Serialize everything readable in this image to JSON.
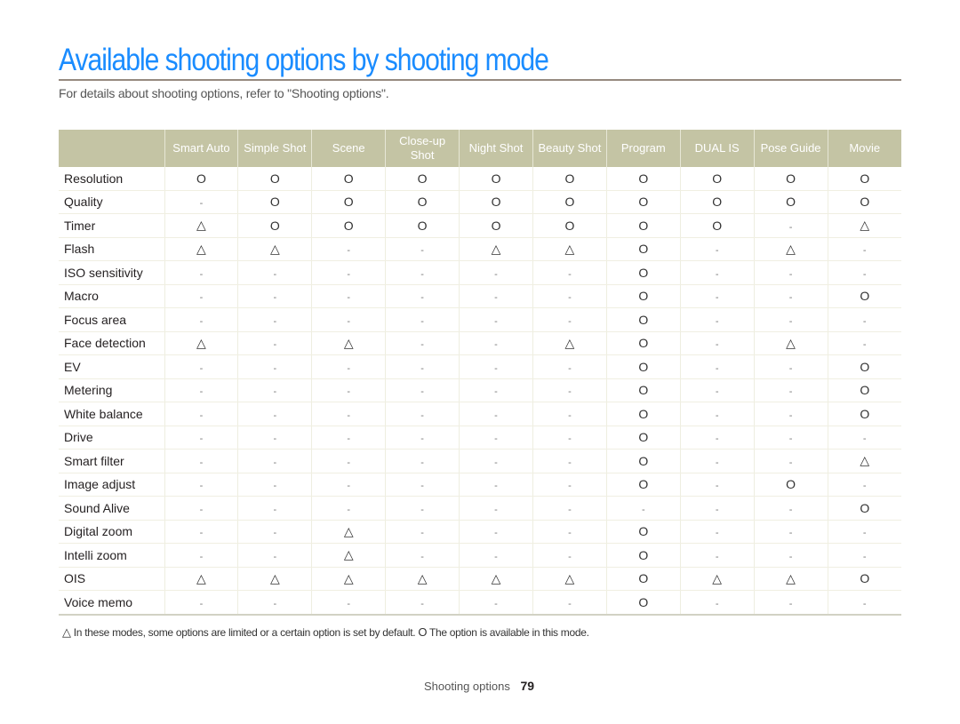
{
  "page": {
    "title": "Available shooting options by shooting mode",
    "subtitle": "For details about shooting options, refer to \"Shooting options\".",
    "footer_section": "Shooting options",
    "page_number": "79"
  },
  "legend": {
    "triangle_symbol": "△",
    "triangle_text": "In these modes, some options are limited or a certain option is set by default.",
    "circle_symbol": "O",
    "circle_text": "The option is available in this mode."
  },
  "symbols": {
    "O": "circle-icon",
    "T": "triangle-icon",
    "-": "dash"
  },
  "table": {
    "headers": [
      "",
      "Smart Auto",
      "Simple Shot",
      "Scene",
      "Close-up Shot",
      "Night Shot",
      "Beauty Shot",
      "Program",
      "DUAL IS",
      "Pose Guide",
      "Movie"
    ],
    "rows": [
      {
        "label": "Resolution",
        "cells": [
          "O",
          "O",
          "O",
          "O",
          "O",
          "O",
          "O",
          "O",
          "O",
          "O"
        ]
      },
      {
        "label": "Quality",
        "cells": [
          "-",
          "O",
          "O",
          "O",
          "O",
          "O",
          "O",
          "O",
          "O",
          "O"
        ]
      },
      {
        "label": "Timer",
        "cells": [
          "T",
          "O",
          "O",
          "O",
          "O",
          "O",
          "O",
          "O",
          "-",
          "T"
        ]
      },
      {
        "label": "Flash",
        "cells": [
          "T",
          "T",
          "-",
          "-",
          "T",
          "T",
          "O",
          "-",
          "T",
          "-"
        ]
      },
      {
        "label": "ISO sensitivity",
        "cells": [
          "-",
          "-",
          "-",
          "-",
          "-",
          "-",
          "O",
          "-",
          "-",
          "-"
        ]
      },
      {
        "label": "Macro",
        "cells": [
          "-",
          "-",
          "-",
          "-",
          "-",
          "-",
          "O",
          "-",
          "-",
          "O"
        ]
      },
      {
        "label": "Focus area",
        "cells": [
          "-",
          "-",
          "-",
          "-",
          "-",
          "-",
          "O",
          "-",
          "-",
          "-"
        ]
      },
      {
        "label": "Face detection",
        "cells": [
          "T",
          "-",
          "T",
          "-",
          "-",
          "T",
          "O",
          "-",
          "T",
          "-"
        ]
      },
      {
        "label": "EV",
        "cells": [
          "-",
          "-",
          "-",
          "-",
          "-",
          "-",
          "O",
          "-",
          "-",
          "O"
        ]
      },
      {
        "label": "Metering",
        "cells": [
          "-",
          "-",
          "-",
          "-",
          "-",
          "-",
          "O",
          "-",
          "-",
          "O"
        ]
      },
      {
        "label": "White balance",
        "cells": [
          "-",
          "-",
          "-",
          "-",
          "-",
          "-",
          "O",
          "-",
          "-",
          "O"
        ]
      },
      {
        "label": "Drive",
        "cells": [
          "-",
          "-",
          "-",
          "-",
          "-",
          "-",
          "O",
          "-",
          "-",
          "-"
        ]
      },
      {
        "label": "Smart filter",
        "cells": [
          "-",
          "-",
          "-",
          "-",
          "-",
          "-",
          "O",
          "-",
          "-",
          "T"
        ]
      },
      {
        "label": "Image adjust",
        "cells": [
          "-",
          "-",
          "-",
          "-",
          "-",
          "-",
          "O",
          "-",
          "O",
          "-"
        ]
      },
      {
        "label": "Sound Alive",
        "cells": [
          "-",
          "-",
          "-",
          "-",
          "-",
          "-",
          "-",
          "-",
          "-",
          "O"
        ]
      },
      {
        "label": "Digital zoom",
        "cells": [
          "-",
          "-",
          "T",
          "-",
          "-",
          "-",
          "O",
          "-",
          "-",
          "-"
        ]
      },
      {
        "label": "Intelli zoom",
        "cells": [
          "-",
          "-",
          "T",
          "-",
          "-",
          "-",
          "O",
          "-",
          "-",
          "-"
        ]
      },
      {
        "label": "OIS",
        "cells": [
          "T",
          "T",
          "T",
          "T",
          "T",
          "T",
          "O",
          "T",
          "T",
          "O"
        ]
      },
      {
        "label": "Voice memo",
        "cells": [
          "-",
          "-",
          "-",
          "-",
          "-",
          "-",
          "O",
          "-",
          "-",
          "-"
        ]
      }
    ]
  },
  "colors": {
    "title": "#1a8cff",
    "header_bg": "#c4c4a4",
    "header_text": "#ffffff",
    "rule": "#968a80"
  }
}
